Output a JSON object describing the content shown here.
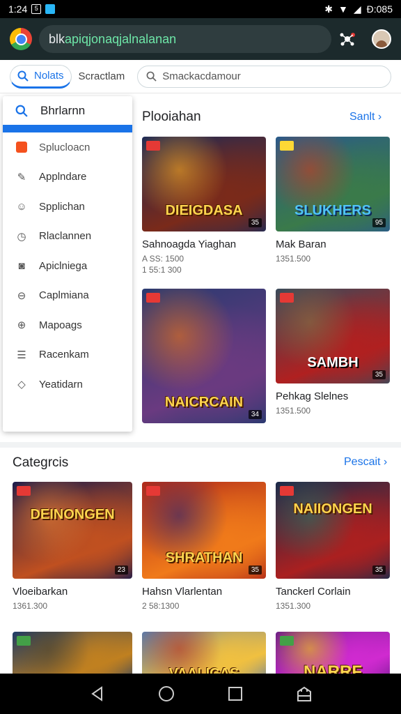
{
  "status": {
    "time": "1:24",
    "right_text": "Ɖ:085"
  },
  "browser": {
    "url_prefix": "blk ",
    "url_highlight": "apiqjonaqjalnalanan"
  },
  "tabs": {
    "active_label": "Nolats",
    "second_label": "Scractlam",
    "search_placeholder": "Smackacdamour"
  },
  "drawer": {
    "header": "Bhrlarnn",
    "items": [
      {
        "label": "Splucloacn",
        "icon": "app-square-icon"
      },
      {
        "label": "Applndare",
        "icon": "edit-icon"
      },
      {
        "label": "Spplichan",
        "icon": "smile-icon"
      },
      {
        "label": "Rlaclannen",
        "icon": "clock-icon"
      },
      {
        "label": "Apiclniega",
        "icon": "camera-icon"
      },
      {
        "label": "Caplmiana",
        "icon": "ball-icon"
      },
      {
        "label": "Mapoags",
        "icon": "globe-icon"
      },
      {
        "label": "Racenkam",
        "icon": "list-icon"
      },
      {
        "label": "Yeatidarn",
        "icon": "tag-icon"
      }
    ]
  },
  "popular": {
    "title": "Plooiahan",
    "see_all": "Sanlt",
    "cards": [
      {
        "art": "DIEIGDASA",
        "badge": "35",
        "title": "Sahnoagda Yiaghan",
        "meta1": "A SS: 1500",
        "meta2": "1 55:1 300",
        "colors": [
          "#1e2a55",
          "#7a2a1a",
          "#f0a020"
        ]
      },
      {
        "art": "SLUKHERS",
        "badge": "95",
        "title": "Mak Baran",
        "meta1": "1351.500",
        "meta2": "",
        "colors": [
          "#2a5a8a",
          "#3a7a4a",
          "#c04020"
        ]
      },
      {
        "art": "NAICRCAIN",
        "badge": "34",
        "title": "",
        "meta1": "",
        "meta2": "",
        "colors": [
          "#2a3a70",
          "#6a3a80",
          "#e07020"
        ]
      },
      {
        "art": "SAMBH",
        "badge": "35",
        "title": "Pehkag Slelnes",
        "meta1": "1351.500",
        "meta2": "",
        "colors": [
          "#3a4a5a",
          "#b02020",
          "#8a6a40"
        ]
      }
    ]
  },
  "categories": {
    "title": "Categrcis",
    "see_all": "Pescait",
    "cards": [
      {
        "art": "DEINONGEN",
        "badge": "23",
        "title": "Vloeibarkan",
        "meta": "1361.300",
        "colors": [
          "#1a1a4a",
          "#c05020",
          "#f08030"
        ]
      },
      {
        "art": "SHRATHAN",
        "badge": "35",
        "title": "Hahsn Vlarlentan",
        "meta": "2 58:1300",
        "colors": [
          "#b02a1a",
          "#f07a1a",
          "#3a2a6a"
        ]
      },
      {
        "art": "NAIIONGEN",
        "badge": "35",
        "title": "Tanckerl Corlain",
        "meta": "1351.300",
        "colors": [
          "#1a2a4a",
          "#aa2020",
          "#3a6a5a"
        ]
      },
      {
        "art": "",
        "badge": "",
        "title": "",
        "meta": "",
        "colors": [
          "#1a3a6a",
          "#c08020",
          "#5a4a2a"
        ]
      },
      {
        "art": "VAALICAS",
        "badge": "",
        "title": "",
        "meta": "",
        "colors": [
          "#5a7aaa",
          "#f0c040",
          "#c04020"
        ]
      },
      {
        "art": "NARRF",
        "badge": "",
        "title": "",
        "meta": "",
        "colors": [
          "#6a1a8a",
          "#d02ad0",
          "#f0c020"
        ]
      }
    ]
  }
}
